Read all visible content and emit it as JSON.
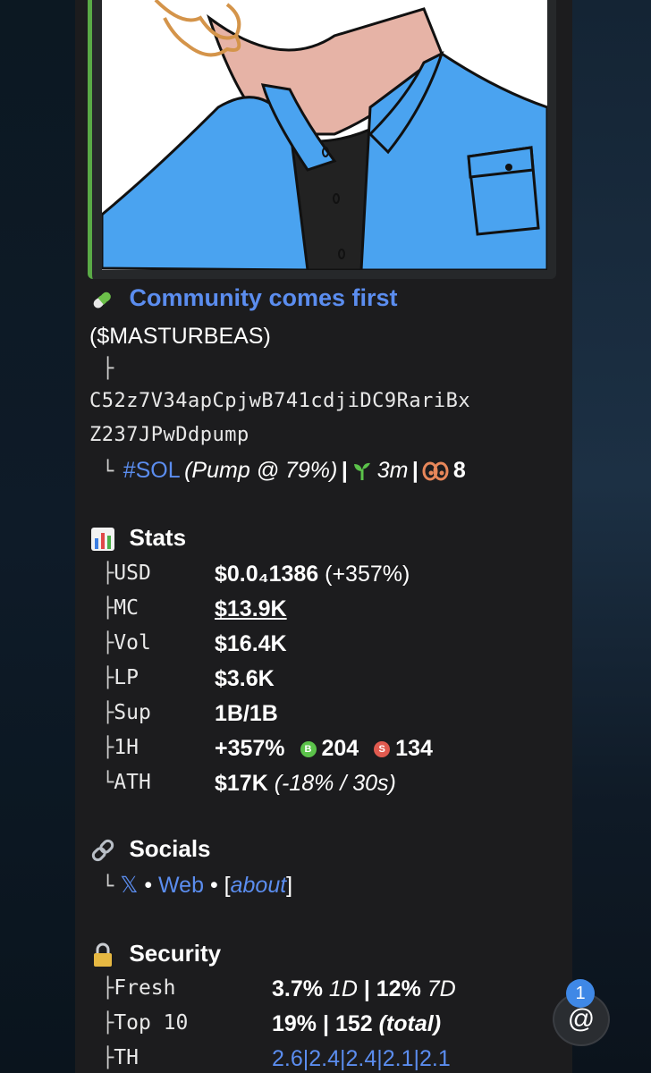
{
  "post": {
    "title": "Community comes first",
    "ticker": "($MASTURBEAS)",
    "tree_branch": "├",
    "address_line1": "C52z7V34apCpjwB741cdjiDC9RariBx",
    "address_line2": "Z237JPwDdpump",
    "chain_prefix": "└",
    "chain": "#SOL",
    "pump": "(Pump @ 79%)",
    "sep": "|",
    "age": "3m",
    "holders": "8"
  },
  "stats": {
    "header": "Stats",
    "rows": [
      {
        "branch": "├",
        "label": "USD",
        "value": "$0.0₄1386",
        "extra": " (+357%)"
      },
      {
        "branch": "├",
        "label": "MC",
        "value": "$13.9K",
        "extra": ""
      },
      {
        "branch": "├",
        "label": "Vol",
        "value": "$16.4K",
        "extra": ""
      },
      {
        "branch": "├",
        "label": "LP",
        "value": "$3.6K",
        "extra": ""
      },
      {
        "branch": "├",
        "label": "Sup",
        "value": "1B/1B",
        "extra": ""
      },
      {
        "branch": "├",
        "label": "1H",
        "value": "+357%",
        "buys": "204",
        "sells": "134"
      },
      {
        "branch": "└",
        "label": "ATH",
        "value": "$17K",
        "extra": "(-18% / 30s)"
      }
    ]
  },
  "socials": {
    "header": "Socials",
    "branch": "└",
    "x": "𝕏",
    "dot": "•",
    "web": "Web",
    "about_open": "[",
    "about": "about",
    "about_close": "]"
  },
  "security": {
    "header": "Security",
    "rows": [
      {
        "branch": "├",
        "label": "Fresh",
        "v1": "3.7%",
        "i1": " 1D",
        "sep": " | ",
        "v2": "12%",
        "i2": " 7D"
      },
      {
        "branch": "├",
        "label": "Top 10",
        "v1": "19%",
        "sep": " | ",
        "v2": "152",
        "i2": " (total)"
      },
      {
        "branch": "├",
        "label": "TH",
        "th": "2.6|2.4|2.4|2.1|2.1"
      }
    ]
  },
  "badge": {
    "count": "1",
    "mention": "@"
  },
  "colors": {
    "accent": "#5b8def",
    "bar": "#5aaa46",
    "buy": "#5bc24a",
    "sell": "#e05a4f"
  }
}
